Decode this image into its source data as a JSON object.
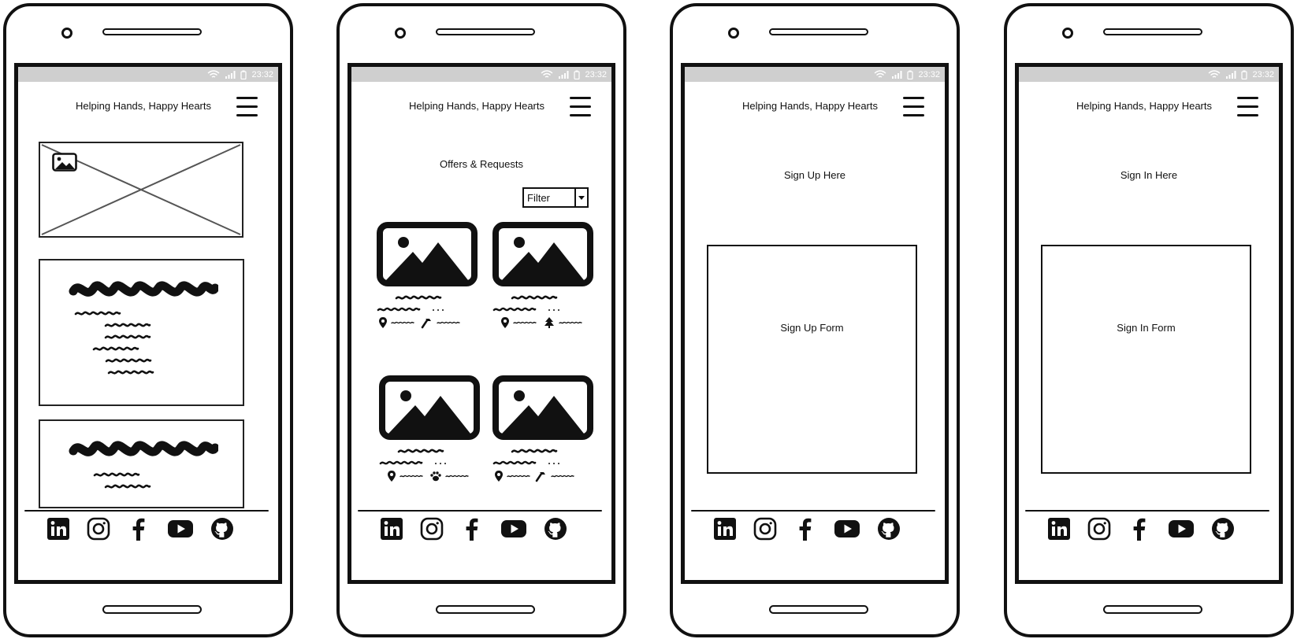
{
  "app": {
    "title": "Helping Hands, Happy Hearts",
    "status_time": "23:32"
  },
  "screens": [
    {
      "id": "home",
      "cards_count": 2
    },
    {
      "id": "offers",
      "page_title": "Offers & Requests",
      "filter": {
        "label": "Filter",
        "icon": "chevron-down-icon"
      },
      "listings": [
        {
          "category_icon": "hammer-icon"
        },
        {
          "category_icon": "tree-icon"
        },
        {
          "category_icon": "paw-icon"
        },
        {
          "category_icon": "hammer-icon"
        }
      ]
    },
    {
      "id": "signup",
      "page_title": "Sign Up Here",
      "form_label": "Sign Up Form"
    },
    {
      "id": "signin",
      "page_title": "Sign In Here",
      "form_label": "Sign In Form"
    }
  ],
  "footer": {
    "social_icons": [
      "linkedin-icon",
      "instagram-icon",
      "facebook-icon",
      "youtube-icon",
      "github-icon"
    ]
  },
  "colors": {
    "ink": "#111111",
    "statusbar": "#cfcfcf"
  }
}
